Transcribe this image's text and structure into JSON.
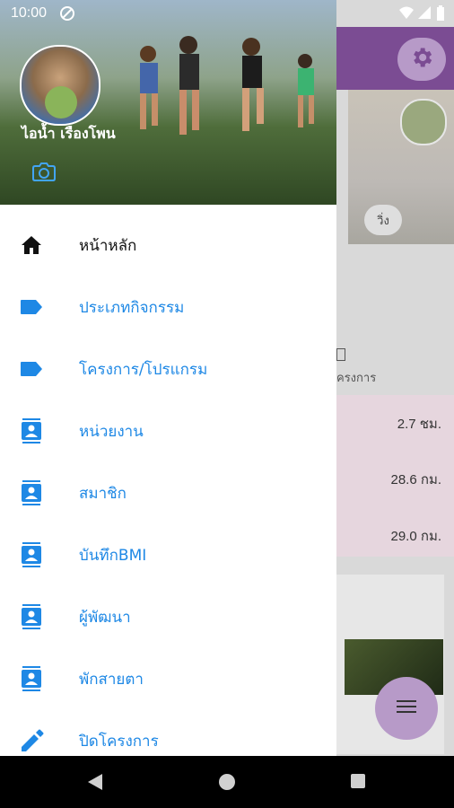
{
  "status_bar": {
    "time": "10:00",
    "icons": [
      "wifi-icon",
      "signal-icon",
      "battery-icon"
    ]
  },
  "drawer": {
    "user_name": "ไอน้ำ เรืองโพน",
    "items": [
      {
        "label": "หน้าหลัก",
        "icon": "home-icon"
      },
      {
        "label": "ประเภทกิจกรรม",
        "icon": "label-icon"
      },
      {
        "label": "โครงการ/โปรแกรม",
        "icon": "label-icon"
      },
      {
        "label": "หน่วยงาน",
        "icon": "contacts-icon"
      },
      {
        "label": "สมาชิก",
        "icon": "contacts-icon"
      },
      {
        "label": "บันทึกBMI",
        "icon": "contacts-icon"
      },
      {
        "label": "ผู้พัฒนา",
        "icon": "contacts-icon"
      },
      {
        "label": "พักสายตา",
        "icon": "contacts-icon"
      },
      {
        "label": "ปิดโครงการ",
        "icon": "pencil-icon"
      }
    ]
  },
  "background": {
    "chip_label": "วิ่ง",
    "subtitle": "ครงการ",
    "stats": [
      "2.7 ชม.",
      "28.6 กม.",
      "29.0 กม."
    ]
  },
  "colors": {
    "accent": "#1e88e5",
    "primary": "#7b4c93",
    "fab": "#b79ac8"
  }
}
